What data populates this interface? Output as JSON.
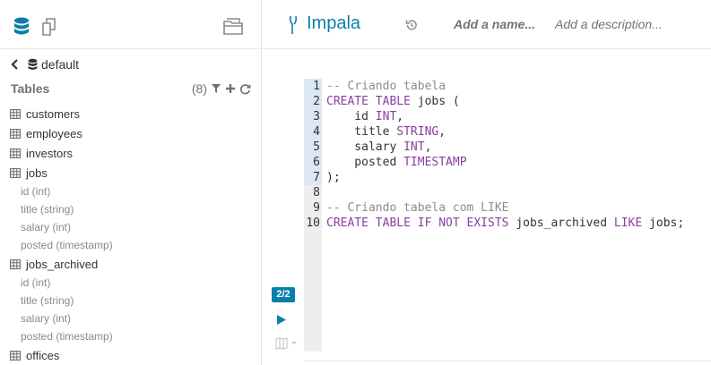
{
  "left_panel": {
    "toolbar_icons": [
      "database-icon",
      "documents-icon",
      "folder-icon"
    ],
    "breadcrumb": {
      "back_icon": "chevron-left-icon",
      "database": "default"
    },
    "tables_header": {
      "title": "Tables",
      "count": "(8)"
    },
    "items": [
      {
        "kind": "table",
        "label": "customers"
      },
      {
        "kind": "table",
        "label": "employees"
      },
      {
        "kind": "table",
        "label": "investors"
      },
      {
        "kind": "table",
        "label": "jobs"
      },
      {
        "kind": "column",
        "label": "id (int)"
      },
      {
        "kind": "column",
        "label": "title (string)"
      },
      {
        "kind": "column",
        "label": "salary (int)"
      },
      {
        "kind": "column",
        "label": "posted (timestamp)"
      },
      {
        "kind": "table",
        "label": "jobs_archived"
      },
      {
        "kind": "column",
        "label": "id (int)"
      },
      {
        "kind": "column",
        "label": "title (string)"
      },
      {
        "kind": "column",
        "label": "salary (int)"
      },
      {
        "kind": "column",
        "label": "posted (timestamp)"
      },
      {
        "kind": "table",
        "label": "offices"
      }
    ]
  },
  "editor_header": {
    "engine": "Impala",
    "name_placeholder": "Add a name...",
    "description_placeholder": "Add a description..."
  },
  "editor": {
    "active_lines": [
      1,
      2,
      3,
      4,
      5,
      6,
      7
    ],
    "lines": [
      [
        [
          "cm",
          "-- Criando tabela"
        ]
      ],
      [
        [
          "kw",
          "CREATE TABLE"
        ],
        [
          "pl",
          " jobs ("
        ]
      ],
      [
        [
          "pl",
          "    id "
        ],
        [
          "kw",
          "INT"
        ],
        [
          "pl",
          ","
        ]
      ],
      [
        [
          "pl",
          "    title "
        ],
        [
          "kw",
          "STRING"
        ],
        [
          "pl",
          ","
        ]
      ],
      [
        [
          "pl",
          "    salary "
        ],
        [
          "kw",
          "INT"
        ],
        [
          "pl",
          ","
        ]
      ],
      [
        [
          "pl",
          "    posted "
        ],
        [
          "kw",
          "TIMESTAMP"
        ]
      ],
      [
        [
          "pl",
          ");"
        ]
      ],
      [
        [
          "pl",
          ""
        ]
      ],
      [
        [
          "cm",
          "-- Criando tabela com LIKE"
        ]
      ],
      [
        [
          "kw",
          "CREATE TABLE IF NOT EXISTS"
        ],
        [
          "pl",
          " jobs_archived "
        ],
        [
          "kw",
          "LIKE"
        ],
        [
          "pl",
          " jobs;"
        ]
      ]
    ],
    "statement_badge": "2/2"
  },
  "colors": {
    "accent": "#0b7fab",
    "keyword": "#8a3fa0",
    "comment": "#8c8c8c",
    "icon": "#737373"
  }
}
